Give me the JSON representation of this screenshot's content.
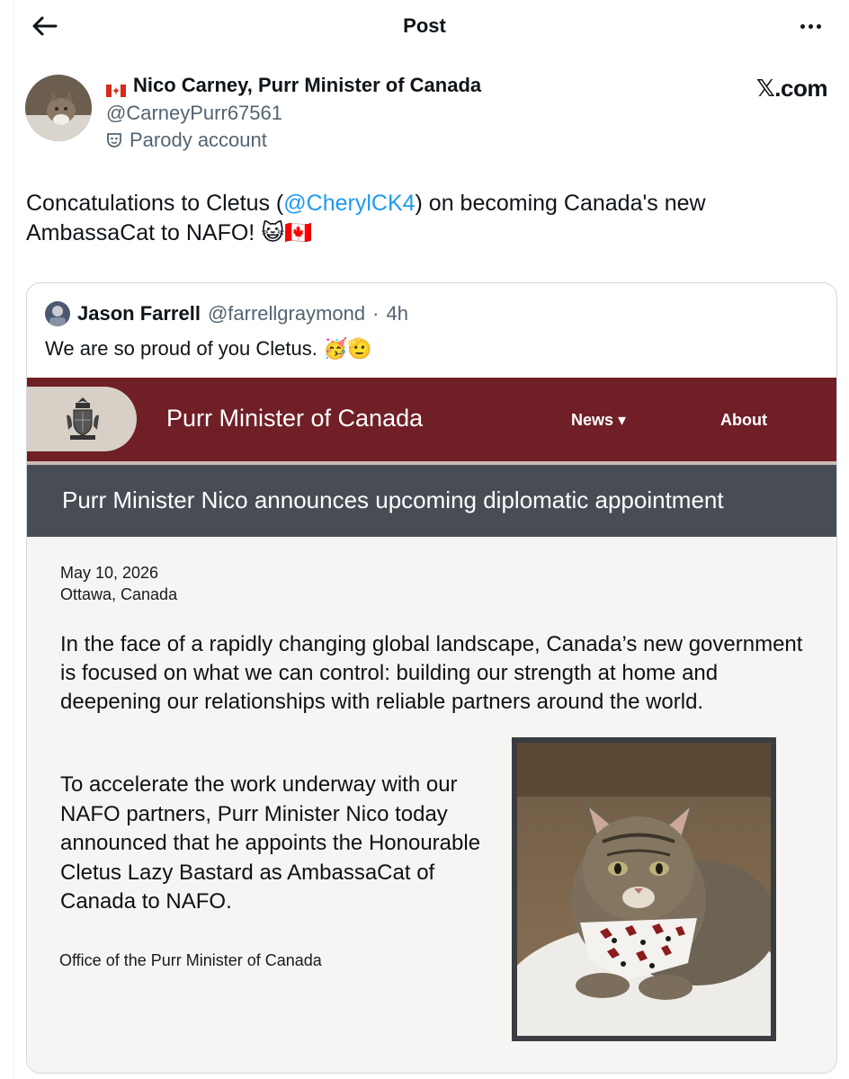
{
  "header": {
    "title": "Post"
  },
  "post": {
    "author_name": "Nico Carney, Purr Minister of Canada",
    "author_handle": "@CarneyPurr67561",
    "parody_label": "Parody account",
    "source_label": "𝕏.com",
    "text_before": "Concatulations to Cletus (",
    "mention": "@CherylCK4",
    "text_after": ") on becoming Canada's new AmbassaCat to NAFO! 😺🇨🇦"
  },
  "quote": {
    "name": "Jason Farrell",
    "handle": "@farrellgraymond",
    "separator": "·",
    "time": "4h",
    "text": "We are so proud of you Cletus. 🥳🫡"
  },
  "embedded_page": {
    "site_title": "Purr Minister of Canada",
    "nav_news": "News ▾",
    "nav_about": "About",
    "headline": "Purr Minister Nico announces upcoming diplomatic appointment",
    "date": "May 10, 2026",
    "location": "Ottawa, Canada",
    "paragraph1": "In the face of a rapidly changing global landscape, Canada’s new government is focused on what we can control: building our strength at home and deepening our relationships with reliable partners around the world.",
    "paragraph2": "To accelerate the work underway with our NAFO partners, Purr Minister Nico today announced that he appoints the Honourable Cletus Lazy Bastard as AmbassaCat of Canada to NAFO.",
    "signature": "Office of the Purr Minister of Canada"
  },
  "colors": {
    "accent_link": "#1d9bf0",
    "gov_banner": "#701f27",
    "headline_band": "#484d55",
    "secondary_text": "#536471"
  },
  "icons": [
    "back-arrow-icon",
    "more-options-icon",
    "canada-flag-icon",
    "parody-mask-icon",
    "coat-of-arms-icon"
  ]
}
